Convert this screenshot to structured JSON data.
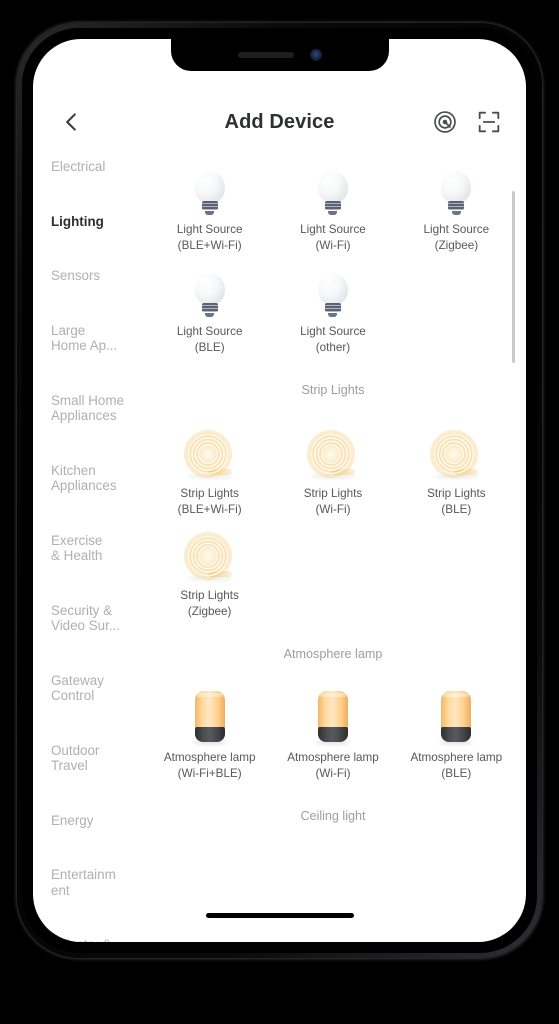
{
  "header": {
    "title": "Add Device",
    "back_icon": "chevron-left-icon",
    "actions": [
      {
        "name": "auto-scan-icon",
        "label": "Auto Scan"
      },
      {
        "name": "qr-scan-icon",
        "label": "Scan QR Code"
      }
    ]
  },
  "sidebar": {
    "active": "Lighting",
    "items": [
      {
        "label": "Electrical",
        "active": false
      },
      {
        "label": "Lighting",
        "active": true
      },
      {
        "label": "Sensors",
        "active": false
      },
      {
        "label": "Large\nHome Ap...",
        "active": false
      },
      {
        "label": "Small Home\nAppliances",
        "active": false
      },
      {
        "label": "Kitchen\nAppliances",
        "active": false
      },
      {
        "label": "Exercise\n& Health",
        "active": false
      },
      {
        "label": "Security &\nVideo Sur...",
        "active": false
      },
      {
        "label": "Gateway\nControl",
        "active": false
      },
      {
        "label": "Outdoor\nTravel",
        "active": false
      },
      {
        "label": "Energy",
        "active": false
      },
      {
        "label": "Entertainm\nent",
        "active": false
      },
      {
        "label": "Industry &\nAgriculture",
        "active": false
      }
    ]
  },
  "sections": [
    {
      "heading": "",
      "icon": "light-bulb-icon",
      "devices": [
        {
          "name": "Light Source",
          "protocol": "(BLE+Wi-Fi)"
        },
        {
          "name": "Light Source",
          "protocol": "(Wi-Fi)"
        },
        {
          "name": "Light Source",
          "protocol": "(Zigbee)"
        },
        {
          "name": "Light Source",
          "protocol": "(BLE)"
        },
        {
          "name": "Light Source",
          "protocol": "(other)"
        }
      ]
    },
    {
      "heading": "Strip Lights",
      "icon": "strip-light-icon",
      "devices": [
        {
          "name": "Strip Lights",
          "protocol": "(BLE+Wi-Fi)"
        },
        {
          "name": "Strip Lights",
          "protocol": "(Wi-Fi)"
        },
        {
          "name": "Strip Lights",
          "protocol": "(BLE)"
        },
        {
          "name": "Strip Lights",
          "protocol": "(Zigbee)"
        }
      ]
    },
    {
      "heading": "Atmosphere lamp",
      "icon": "atmosphere-lamp-icon",
      "devices": [
        {
          "name": "Atmosphere lamp",
          "protocol": "(Wi-Fi+BLE)"
        },
        {
          "name": "Atmosphere lamp",
          "protocol": "(Wi-Fi)"
        },
        {
          "name": "Atmosphere lamp",
          "protocol": "(BLE)"
        }
      ]
    },
    {
      "heading": "Ceiling light",
      "icon": "ceiling-light-icon",
      "devices": []
    }
  ],
  "colors": {
    "text_primary": "#2f3033",
    "text_secondary": "#56585c",
    "text_muted": "#b0b0b2",
    "heading_muted": "#9c9ea1",
    "lamp_amber": "#ffd9a0",
    "lamp_base_dark": "#4c4f53",
    "strip_amber": "#f3d89d",
    "scrollbar": "#c9cacd",
    "screen_bg": "#ffffff"
  }
}
